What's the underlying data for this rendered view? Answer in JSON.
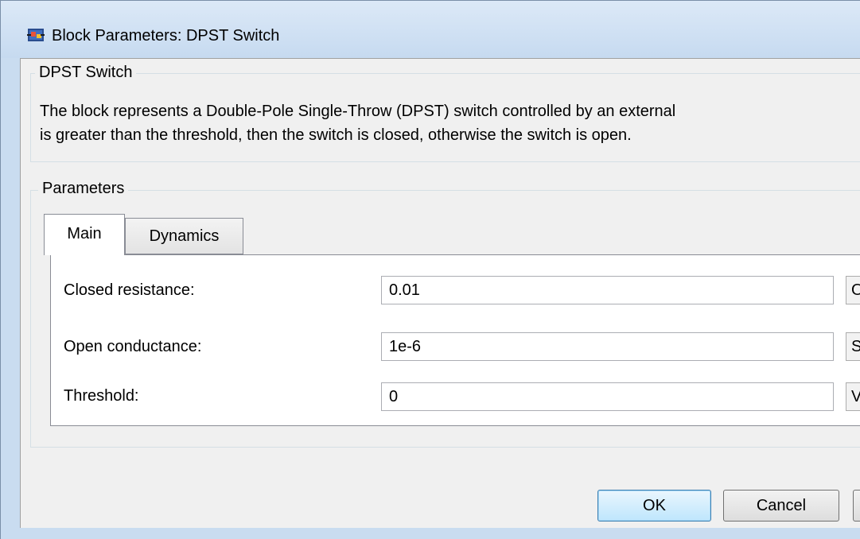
{
  "window": {
    "title": "Block Parameters: DPST Switch",
    "icon": "simulink-block-icon"
  },
  "description_group": {
    "legend": "DPST Switch",
    "lines": [
      "The block represents a Double-Pole Single-Throw (DPST) switch controlled by an external",
      "is greater than the threshold, then the switch is closed, otherwise the switch is open."
    ]
  },
  "parameters_group": {
    "legend": "Parameters",
    "tabs": [
      {
        "label": "Main",
        "selected": true
      },
      {
        "label": "Dynamics",
        "selected": false
      }
    ],
    "fields": [
      {
        "label": "Closed resistance:",
        "value": "0.01",
        "unit": "O"
      },
      {
        "label": "Open conductance:",
        "value": "1e-6",
        "unit": "S"
      },
      {
        "label": "Threshold:",
        "value": "0",
        "unit": "V"
      }
    ]
  },
  "buttons": {
    "ok": "OK",
    "cancel": "Cancel"
  },
  "colors": {
    "titlebar": "#c6daf0",
    "client_background": "#f0f0f0",
    "ok_button_accent": "#3c7fb1"
  }
}
